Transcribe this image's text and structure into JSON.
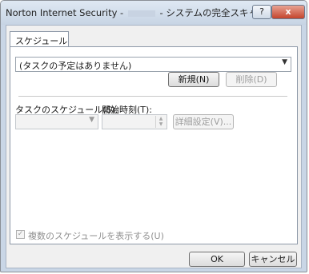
{
  "window": {
    "title_prefix": "Norton Internet Security -",
    "title_suffix": "- システムの完全スキャン",
    "help_label": "?",
    "close_label": "x"
  },
  "tabs": [
    {
      "label": "スケジュール"
    }
  ],
  "schedule": {
    "selected": "(タスクの予定はありません)",
    "new_button": "新規(N)",
    "delete_button": "削除(D)",
    "task_schedule_label": "タスクのスケジュール(S):",
    "start_time_label": "開始時刻(T):",
    "advanced_button": "詳細設定(V)...",
    "multiple_checkbox_label": "複数のスケジュールを表示する(U)",
    "multiple_checked": true
  },
  "footer": {
    "ok_button": "OK",
    "cancel_button": "キャンセル"
  },
  "icons": {
    "dropdown": "chevron-down-icon",
    "spin": "spinner-arrows-icon",
    "check": "checkmark-icon"
  }
}
